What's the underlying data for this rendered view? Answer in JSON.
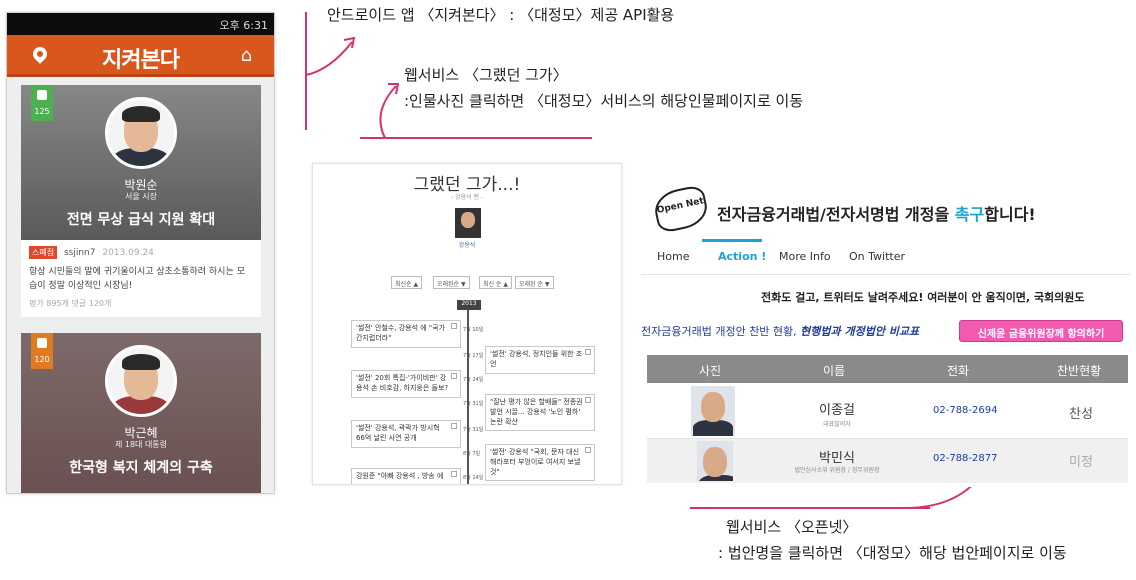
{
  "annotations": {
    "top": "안드로이드 앱 〈지켜본다〉 : 〈대정모〉제공 API활용",
    "middle_line1": "웹서비스 〈그랬던 그가〉",
    "middle_line2": ":인물사진 클릭하면 〈대정모〉서비스의 해당인물페이지로 이동",
    "bottom_line1": "웹서비스 〈오픈넷〉",
    "bottom_line2": ": 법안명을 클릭하면 〈대정모〉해당 법안페이지로 이동"
  },
  "phone": {
    "status_time": "오후 6:31",
    "app_title": "지켜본다",
    "card1": {
      "vote_count": "125",
      "name": "박원순",
      "role": "서울 시장",
      "headline": "전면 무상 급식 지원 확대",
      "badge": "스폐점",
      "user": "ssjinn7",
      "date": "2013.09.24",
      "body": "항상 시민들의 말에 귀기울이시고 상초소통하려 하시는 모습이 정말 이상적인 시장님!",
      "stats": "평가 895개  댓글 120개"
    },
    "card2": {
      "vote_count": "120",
      "name": "박근혜",
      "role": "제 18대 대통령",
      "headline": "한국형 복지 체계의 구축"
    }
  },
  "web1": {
    "title": "그랬던 그가...!",
    "subtitle": "- 강용석 편 -",
    "person_name": "강용석",
    "filters": [
      "최신순 ▲",
      "오래된순 ▼",
      "최신 순 ▲",
      "오래된 순 ▼"
    ],
    "year": "2013",
    "events": [
      "'썰전' 안철수, 강용석 에 \"국가 간지럽더라\"",
      "'썰전' 강용석, 정치인들 위한 조언",
      "'썰전' 20회 특집-'가이비판' 강용석 손 비호감, 하지웅은 들보?",
      "\"잘난 평가 않은 할배들\" 전종권 발언 시끌... 강용석 '노인 폄하' 논란 확산",
      "'썰전' 강용석, 곽곽가 방시혁 66억 날린 사연 공개",
      "'썰전' 강용석 \"국회, 문자 대신 해라포터 부엉이로 여서지 보낼 것\"",
      "강원준 \"아빠 강용석 , 방송 에 .."
    ],
    "dates": [
      "7월 10일",
      "7월 17일",
      "7월 24일",
      "7월 31일",
      "7월 31일",
      "8월 7일",
      "8월 14일"
    ]
  },
  "web2": {
    "logo_text": "Open Net",
    "title_before": "전자금융거래법/전자서명법 개정을 ",
    "title_highlight": "촉구",
    "title_after": "합니다!",
    "nav": [
      "Home",
      "Action !",
      "More Info",
      "On Twitter"
    ],
    "banner": "전화도 걸고, 트위터도 날려주세요! 여러분이 안 움직이면, 국회의원도",
    "row_text": "전자금융거래법 개정안 찬반 현황, ",
    "row_link": "현행법과 개정법안 비교표",
    "pink_button": "신제윤 금융위원장께 항의하기",
    "table_headers": [
      "사진",
      "이름",
      "전화",
      "찬반현황"
    ],
    "rows": [
      {
        "name": "이종걸",
        "role": "대표발의자",
        "phone": "02-788-2694",
        "status": "찬성"
      },
      {
        "name": "박민식",
        "role": "법안심사소위 위원장 / 정무위원장",
        "phone": "02-788-2877",
        "status": "미정"
      }
    ]
  },
  "colors": {
    "accent_orange": "#d9571c",
    "openNet_blue": "#1aa3d4",
    "annotation_pink": "#d6306e",
    "pink_button": "#f25ab0"
  }
}
